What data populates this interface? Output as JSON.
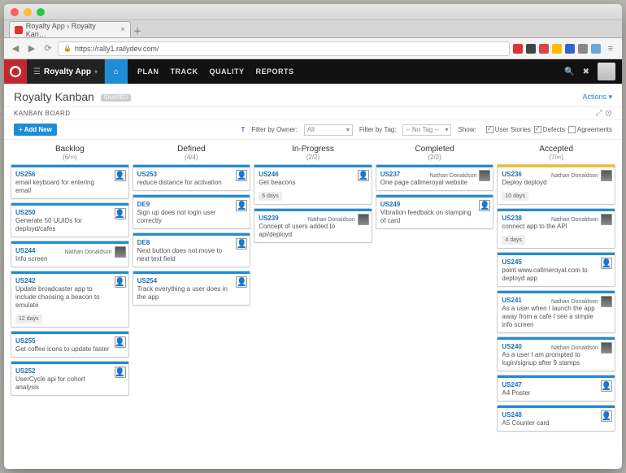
{
  "browser": {
    "tab_title": "Royalty App › Royalty Kan…",
    "url": "https://rally1.rallydev.com/"
  },
  "header": {
    "app_name": "Royalty App",
    "nav": [
      "PLAN",
      "TRACK",
      "QUALITY",
      "REPORTS"
    ]
  },
  "page": {
    "title": "Royalty Kanban",
    "badge": "SHARED",
    "actions_label": "Actions",
    "section": "KANBAN BOARD"
  },
  "toolbar": {
    "add_new": "+ Add New",
    "filter_owner_label": "Filter by Owner:",
    "filter_owner_value": "All",
    "filter_tag_label": "Filter by Tag:",
    "filter_tag_value": "-- No Tag --",
    "show_label": "Show:",
    "show_options": [
      {
        "label": "User Stories",
        "checked": true
      },
      {
        "label": "Defects",
        "checked": true
      },
      {
        "label": "Agreements",
        "checked": false
      }
    ]
  },
  "columns": [
    {
      "name": "Backlog",
      "count": "(6/∞)",
      "cards": [
        {
          "id": "US256",
          "title": "email keyboard for entering email",
          "owner": null,
          "color": "blue"
        },
        {
          "id": "US250",
          "title": "Generate 50 UUIDs for deployd/cafes",
          "owner": null,
          "color": "blue"
        },
        {
          "id": "US244",
          "title": "Info screen",
          "owner": "Nathan Donaldson",
          "color": "blue"
        },
        {
          "id": "US242",
          "title": "Update broadcaster app to include choosing a beacon to emulate",
          "owner": null,
          "color": "blue",
          "age": "12 days"
        },
        {
          "id": "US255",
          "title": "Get coffee icons to update faster",
          "owner": null,
          "color": "blue"
        },
        {
          "id": "US252",
          "title": "UserCycle api for cohort analysis",
          "owner": null,
          "color": "blue"
        }
      ]
    },
    {
      "name": "Defined",
      "count": "(4/4)",
      "cards": [
        {
          "id": "US253",
          "title": "reduce distance for activation",
          "owner": null,
          "color": "blue"
        },
        {
          "id": "DE9",
          "title": "Sign up does not login user correctly",
          "owner": null,
          "color": "blue"
        },
        {
          "id": "DE8",
          "title": "Next button does not move to next text field",
          "owner": null,
          "color": "blue"
        },
        {
          "id": "US254",
          "title": "Track everything a user does in the app",
          "owner": null,
          "color": "blue"
        }
      ]
    },
    {
      "name": "In-Progress",
      "count": "(2/2)",
      "cards": [
        {
          "id": "US246",
          "title": "Get beacons",
          "owner": null,
          "color": "blue",
          "age": "6 days"
        },
        {
          "id": "US239",
          "title": "Concept of users added to api/deployd",
          "owner": "Nathan Donaldson",
          "color": "blue"
        }
      ]
    },
    {
      "name": "Completed",
      "count": "(2/2)",
      "cards": [
        {
          "id": "US237",
          "title": "One page callmeroyal website",
          "owner": "Nathan Donaldson",
          "color": "blue"
        },
        {
          "id": "US249",
          "title": "Vibration feedback on stamping of card",
          "owner": null,
          "color": "blue"
        }
      ]
    },
    {
      "name": "Accepted",
      "count": "(7/∞)",
      "cards": [
        {
          "id": "US236",
          "title": "Deploy deployd",
          "owner": "Nathan Donaldson",
          "color": "yellow",
          "age": "10 days"
        },
        {
          "id": "US238",
          "title": "connect app to the API",
          "owner": "Nathan Donaldson",
          "color": "blue",
          "age": "4 days"
        },
        {
          "id": "US245",
          "title": "point www.callmeroyal.com to deployd app",
          "owner": null,
          "color": "blue"
        },
        {
          "id": "US241",
          "title": "As a user when I launch the app away from a cafe I see a simple info screen",
          "owner": "Nathan Donaldson",
          "color": "blue"
        },
        {
          "id": "US240",
          "title": "As a user I am prompted to login/signup after 9 stamps",
          "owner": "Nathan Donaldson",
          "color": "blue"
        },
        {
          "id": "US247",
          "title": "A4 Poster",
          "owner": null,
          "color": "blue"
        },
        {
          "id": "US248",
          "title": "A5 Counter card",
          "owner": null,
          "color": "blue"
        }
      ]
    }
  ]
}
